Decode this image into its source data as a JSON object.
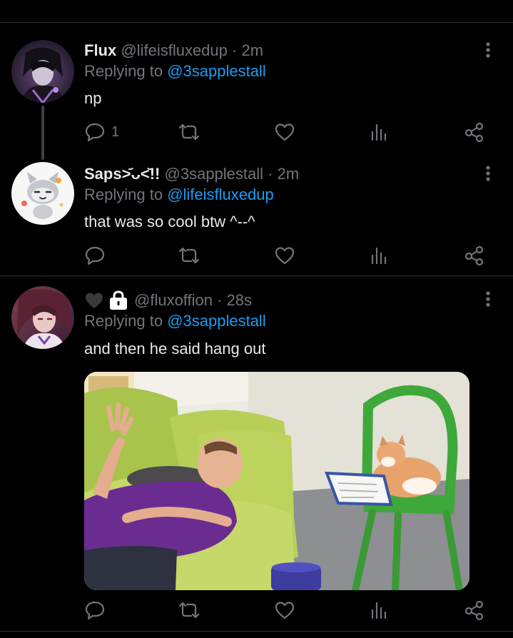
{
  "tweets": [
    {
      "display_name": "Flux",
      "handle": "@lifeisfluxedup",
      "time": "· 2m",
      "replying_prefix": "Replying to ",
      "replying_to": "@3sapplestall",
      "text": "np",
      "reply_count": "1"
    },
    {
      "display_name": "Saps",
      "name_emoticon": ">᷄ᴗ<᷅!!",
      "handle": "@3sapplestall",
      "time": "· 2m",
      "replying_prefix": "Replying to ",
      "replying_to": "@lifeisfluxedup",
      "text": "that was so cool btw ^--^",
      "reply_count": ""
    },
    {
      "display_name_icons": [
        "black-heart-icon",
        "lock-icon"
      ],
      "handle": "@fluxoffion",
      "time": "· 28s",
      "replying_prefix": "Replying to ",
      "replying_to": "@3sapplestall",
      "text": "and then he said hang out",
      "reply_count": ""
    }
  ],
  "icons": {
    "reply": "speech-bubble-icon",
    "retweet": "retweet-icon",
    "like": "heart-icon",
    "views": "bar-chart-icon",
    "share": "share-icon",
    "more": "vertical-ellipsis-icon"
  },
  "colors": {
    "background": "#000000",
    "text": "#e7e9ea",
    "muted": "#71767b",
    "link": "#1d9bf0",
    "divider": "#2f3336"
  }
}
